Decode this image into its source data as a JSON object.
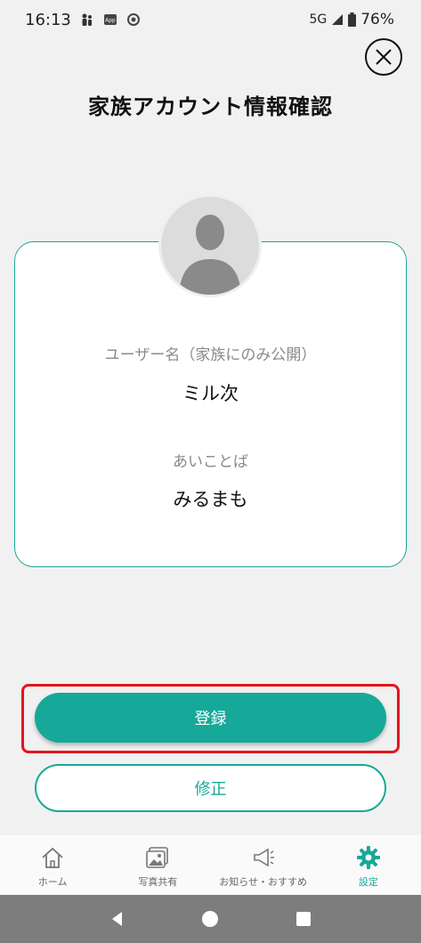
{
  "status_bar": {
    "time": "16:13",
    "network": "5G",
    "battery": "76%"
  },
  "title": "家族アカウント情報確認",
  "card": {
    "username_label": "ユーザー名（家族にのみ公開）",
    "username_value": "ミル次",
    "passphrase_label": "あいことば",
    "passphrase_value": "みるまも"
  },
  "buttons": {
    "register": "登録",
    "modify": "修正"
  },
  "bottom_nav": {
    "home": "ホーム",
    "photos": "写真共有",
    "news": "お知らせ・おすすめ",
    "settings": "設定",
    "active": "settings"
  },
  "colors": {
    "accent": "#16a898",
    "highlight": "#e3161c"
  }
}
